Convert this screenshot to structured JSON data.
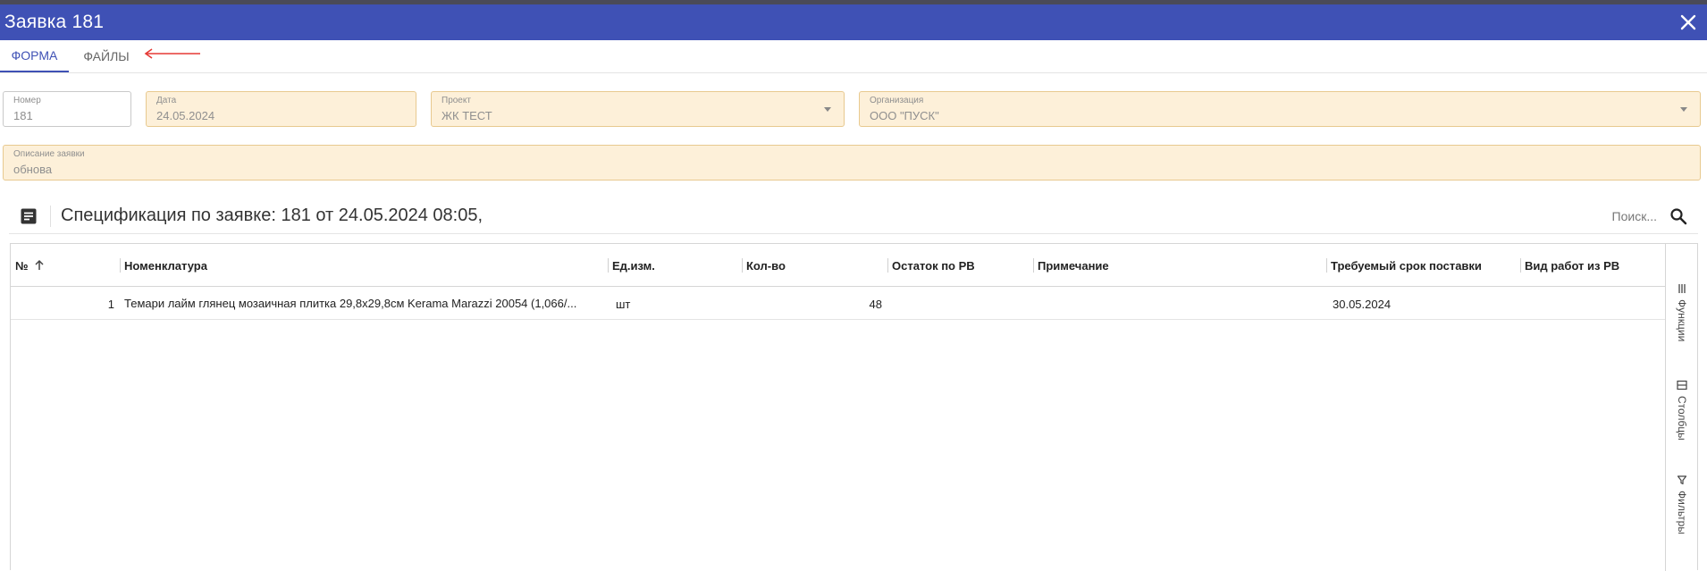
{
  "window": {
    "title": "Заявка 181"
  },
  "tabs": [
    {
      "label": "Форма",
      "active": true
    },
    {
      "label": "Файлы",
      "active": false
    }
  ],
  "form": {
    "number": {
      "label": "Номер",
      "value": "181"
    },
    "date": {
      "label": "Дата",
      "value": "24.05.2024"
    },
    "project": {
      "label": "Проект",
      "value": "ЖК ТЕСТ"
    },
    "organization": {
      "label": "Организация",
      "value": "ООО \"ПУСК\""
    },
    "description": {
      "label": "Описание заявки",
      "value": "обнова"
    }
  },
  "spec": {
    "title": "Спецификация по заявке: 181 от 24.05.2024 08:05,",
    "search_placeholder": "Поиск..."
  },
  "grid": {
    "columns": [
      "№",
      "Номенклатура",
      "Ед.изм.",
      "Кол-во",
      "Остаток по РВ",
      "Примечание",
      "Требуемый срок поставки",
      "Вид работ из РВ"
    ],
    "rows": [
      {
        "num": "1",
        "nomenclature": "Темари лайм глянец мозаичная плитка 29,8х29,8см Kerama Marazzi 20054 (1,066/...",
        "unit": "шт",
        "qty": "48",
        "remainder": "",
        "note": "",
        "deadline": "30.05.2024",
        "work_type": ""
      }
    ]
  },
  "side_panel": [
    {
      "label": "Функции",
      "icon": "menu-icon"
    },
    {
      "label": "Столбцы",
      "icon": "columns-icon"
    },
    {
      "label": "Фильтры",
      "icon": "filter-icon"
    }
  ],
  "colors": {
    "header": "#3f51b5",
    "readonly_field": "#fdf0d9",
    "annotation_arrow": "#e53935"
  }
}
